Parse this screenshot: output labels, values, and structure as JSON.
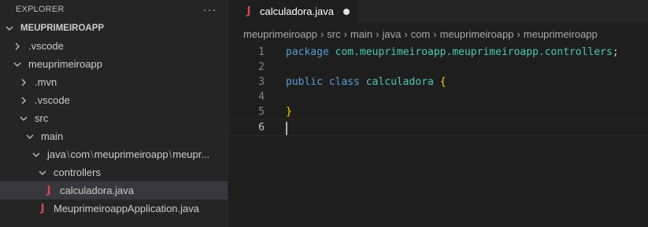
{
  "sidebar": {
    "title": "EXPLORER",
    "more": "···",
    "root": "MEUPRIMEIROAPP",
    "items": [
      {
        "label": ".vscode"
      },
      {
        "label": "meuprimeiroapp"
      },
      {
        "label": ".mvn"
      },
      {
        "label": ".vscode"
      },
      {
        "label": "src"
      },
      {
        "label": "main"
      },
      {
        "label": "java",
        "seg1": "com",
        "seg2": "meuprimeiroapp",
        "seg3": "meupr..."
      },
      {
        "label": "controllers"
      },
      {
        "label": "calculadora.java"
      },
      {
        "label": "MeuprimeiroappApplication.java"
      }
    ],
    "path_separator": "\\"
  },
  "tab": {
    "label": "calculadora.java",
    "icon": "J"
  },
  "breadcrumb": [
    "meuprimeiroapp",
    "src",
    "main",
    "java",
    "com",
    "meuprimeiroapp",
    "meuprimeiroapp"
  ],
  "editor": {
    "line_numbers": [
      "1",
      "2",
      "3",
      "4",
      "5",
      "6"
    ],
    "line1": {
      "kw": "package",
      "pkg": "com.meuprimeiroapp.meuprimeiroapp.controllers",
      "semi": ";"
    },
    "line3": {
      "kw1": "public",
      "kw2": "class",
      "cls": "calculadora",
      "brace": "{"
    },
    "line5": {
      "brace": "}"
    }
  },
  "colors": {
    "keyword": "#569cd6",
    "type": "#4ec9b0",
    "brace": "#ffd700",
    "java_icon": "#d44a4a"
  }
}
